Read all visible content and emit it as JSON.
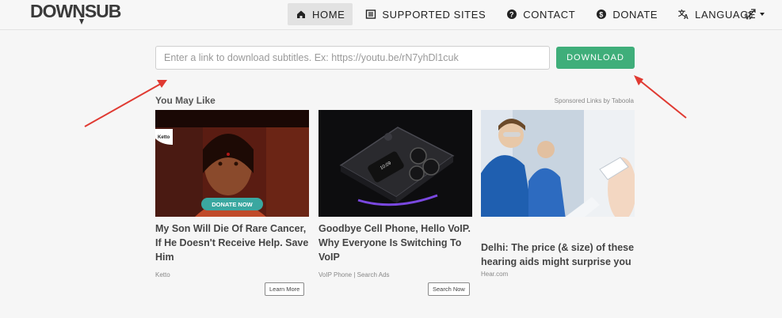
{
  "brand": {
    "logo_text": "DOWNSUB"
  },
  "nav": {
    "items": [
      {
        "label": "HOME",
        "icon": "home-icon",
        "active": true
      },
      {
        "label": "SUPPORTED SITES",
        "icon": "list-icon",
        "active": false
      },
      {
        "label": "CONTACT",
        "icon": "question-icon",
        "active": false
      },
      {
        "label": "DONATE",
        "icon": "dollar-icon",
        "active": false
      },
      {
        "label": "LANGUAGE",
        "icon": "translate-icon",
        "active": false
      }
    ],
    "theme_toggle_icon": "theme-toggle-icon"
  },
  "search": {
    "placeholder": "Enter a link to download subtitles. Ex: https://youtu.be/rN7yhDl1cuk",
    "value": "",
    "button_label": "DOWNLOAD"
  },
  "ads": {
    "heading": "You May Like",
    "sponsored_label": "Sponsored Links by Taboola",
    "cards": [
      {
        "title": "My Son Will Die Of Rare Cancer, If He Doesn't Receive Help. Save Him",
        "source": "Ketto",
        "cta": "Learn More",
        "badge": "Ketto",
        "overlay": "DONATE NOW"
      },
      {
        "title": "Goodbye Cell Phone, Hello VoIP. Why Everyone Is Switching To VoIP",
        "source": "VoIP Phone | Search Ads",
        "cta": "Search Now"
      },
      {
        "title": "Delhi: The price (& size) of these hearing aids might surprise you",
        "source": "Hear.com"
      }
    ]
  },
  "colors": {
    "accent": "#3fae7a",
    "annotation": "#e03a32",
    "active_tab": "#e2e2e2"
  }
}
